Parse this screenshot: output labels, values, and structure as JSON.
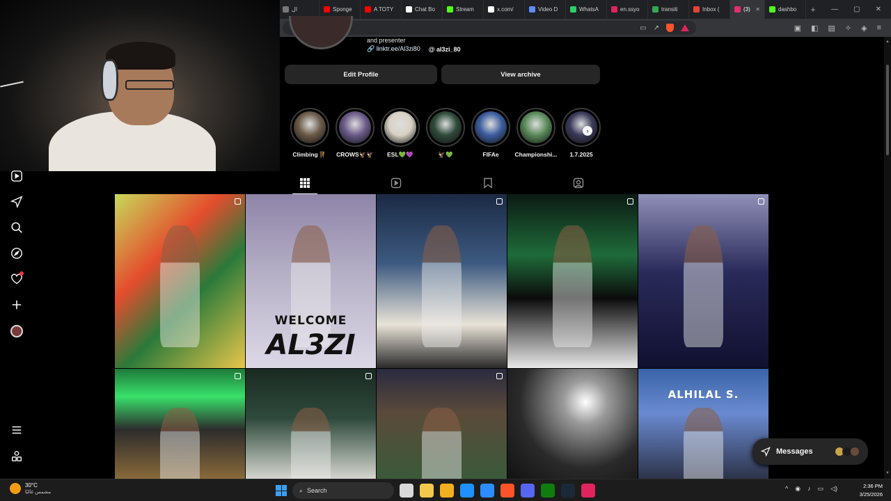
{
  "browser": {
    "tabs": [
      {
        "label": "ال",
        "icon": "generic-icon",
        "color": "#777777"
      },
      {
        "label": "Sponge",
        "icon": "youtube-icon",
        "color": "#ff0000"
      },
      {
        "label": "A TOTY",
        "icon": "youtube-icon",
        "color": "#ff0000"
      },
      {
        "label": "Chat Bo",
        "icon": "openai-icon",
        "color": "#ffffff"
      },
      {
        "label": "Stream",
        "icon": "kick-icon",
        "color": "#53fc18"
      },
      {
        "label": "x.com/",
        "icon": "x-icon",
        "color": "#ffffff"
      },
      {
        "label": "Video D",
        "icon": "globe-icon",
        "color": "#5f8bff"
      },
      {
        "label": "WhatsA",
        "icon": "whatsapp-icon",
        "color": "#25d366"
      },
      {
        "label": "en.ssyo",
        "icon": "ssyoutube-icon",
        "color": "#e0245e"
      },
      {
        "label": "transiti",
        "icon": "drive-icon",
        "color": "#34a853"
      },
      {
        "label": "Inbox (",
        "icon": "gmail-icon",
        "color": "#ea4335"
      },
      {
        "label": "(3)",
        "icon": "instagram-icon",
        "color": "#e1306c",
        "active": true
      },
      {
        "label": "dashbo",
        "icon": "kick-icon",
        "color": "#53fc18"
      }
    ],
    "close_glyph": "✕",
    "new_tab_glyph": "+",
    "window_controls": [
      "—",
      "▢",
      "✕"
    ]
  },
  "profile": {
    "bio_line": "and presenter",
    "link_text": "linktr.ee/Al3zi80",
    "threads_handle": "al3zi_80",
    "edit_button": "Edit Profile",
    "archive_button": "View archive",
    "highlights": [
      {
        "label": "Climbing 🧗",
        "color": "#6b5a48"
      },
      {
        "label": "CROWS🦅🦅",
        "color": "#6a5a88"
      },
      {
        "label": "ESL💚💜",
        "color": "#d8d2c4"
      },
      {
        "label": "🦅💚",
        "color": "#2f4a3a"
      },
      {
        "label": "FIFAe",
        "color": "#3c5d9e"
      },
      {
        "label": "Championshi...",
        "color": "#5a8a5a"
      },
      {
        "label": "1.7.2025",
        "color": "#3a3a5a"
      }
    ],
    "highlights_next": "›",
    "profile_tabs": [
      "posts",
      "reels",
      "saved",
      "tagged"
    ]
  },
  "posts": [
    {
      "bg": "linear-gradient(135deg,#c7d95a 0%,#e44d2e 35%,#2b7a3a 60%,#e8c64a 100%)",
      "multi": true,
      "text": ""
    },
    {
      "bg": "linear-gradient(180deg,#8e84a8 0%,#b9b3c9 50%,#ddd8e6 100%)",
      "multi": false,
      "text": "WELCOME",
      "text2": "AL3ZI"
    },
    {
      "bg": "linear-gradient(180deg,#1b2a45 0%,#3d5a80 40%,#e9e3d8 75%,#2a2a2a 100%)",
      "multi": true,
      "text": ""
    },
    {
      "bg": "linear-gradient(180deg,#0b1a12 0%,#1f6b3a 35%,#0b0b0b 60%,#e8e8e8 100%)",
      "multi": true,
      "text": ""
    },
    {
      "bg": "linear-gradient(180deg,#8f8fb8 0%,#2a2a5a 45%,#101030 100%)",
      "multi": true,
      "text": ""
    },
    {
      "bg": "linear-gradient(180deg,#1d7a3a 0%,#39e06b 25%,#2c2c2c 55%,#8a6a3a 100%)",
      "multi": true,
      "text": ""
    },
    {
      "bg": "linear-gradient(180deg,#1a2a22 0%,#2f4a3c 45%,#d7d7d0 100%)",
      "multi": true,
      "text": ""
    },
    {
      "bg": "linear-gradient(180deg,#2a2a40 0%,#5a4a3a 40%,#3a5a3a 100%)",
      "multi": true,
      "text": ""
    },
    {
      "bg": "radial-gradient(circle at 60% 30%,#ffffff 0%,#9a9a9a 20%,#2a2a2a 60%,#111111 100%)",
      "multi": false,
      "text": ""
    },
    {
      "bg": "linear-gradient(180deg,#3a64a8 0%,#6a8ad0 40%,#2c3248 100%)",
      "multi": false,
      "text": "ALHILAL S."
    }
  ],
  "messages": {
    "label": "Messages",
    "avatar_colors": [
      "#c9a24a",
      "#1a1a1a",
      "#6a4a3a"
    ]
  },
  "taskbar": {
    "weather_temp": "30°C",
    "weather_desc": "مشمس غالبًا",
    "search_placeholder": "Search",
    "apps": [
      "#d9d9d9",
      "#f2c94c",
      "#f2b01e",
      "#1e90ff",
      "#2d8cff",
      "#fb542b",
      "#5865f2",
      "#107c10",
      "#1b2838",
      "#e0245e"
    ],
    "time": "2:36 PM",
    "date": "3/25/2026"
  }
}
